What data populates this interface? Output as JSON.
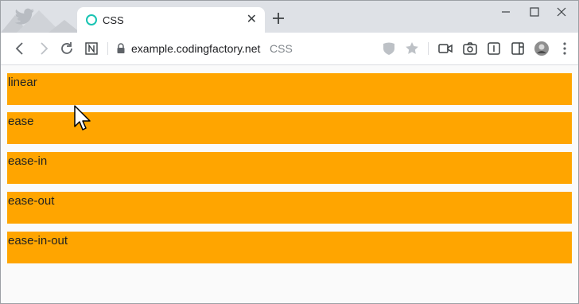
{
  "browser": {
    "tab": {
      "title": "CSS",
      "close_glyph": "✕"
    },
    "address_bar": {
      "url": "example.codingfactory.net",
      "page_title": "CSS"
    }
  },
  "bars": [
    {
      "label": "linear"
    },
    {
      "label": "ease"
    },
    {
      "label": "ease-in"
    },
    {
      "label": "ease-out"
    },
    {
      "label": "ease-in-out"
    }
  ],
  "colors": {
    "bar": "#ffa500",
    "page_bg": "#fafafa",
    "tab_icon": "#17c3b2"
  },
  "icons": [
    "back-icon",
    "forward-icon",
    "reload-icon",
    "notion-icon",
    "lock-icon",
    "shield-icon",
    "star-icon",
    "video-icon",
    "camera-icon",
    "reader-icon",
    "sidebar-icon",
    "avatar",
    "new-tab-icon",
    "minimize-icon",
    "maximize-icon",
    "close-window-icon",
    "cursor-icon"
  ]
}
